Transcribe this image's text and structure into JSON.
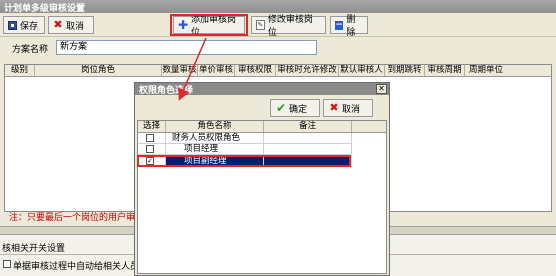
{
  "window": {
    "title": "计划单多级审核设置"
  },
  "toolbar": {
    "save_label": "保存",
    "cancel_label": "取消",
    "add_label": "添加审核岗位",
    "edit_label": "修改审核岗位",
    "delete_label": "删除"
  },
  "scheme": {
    "label": "方案名称",
    "value": "新方案"
  },
  "grid": {
    "columns": [
      "级别",
      "岗位角色",
      "数量审核",
      "单价审核",
      "审核权限",
      "审核时允许修改",
      "默认审核人",
      "到期跳转",
      "审核周期",
      "周期单位"
    ]
  },
  "note": "注：只要最后一个岗位的用户审核",
  "lower": {
    "section_label": "核相关开关设置",
    "checkbox_label": "单据审核过程中自动给相关人员发"
  },
  "dialog": {
    "title": "权限角色选择",
    "ok_label": "确定",
    "cancel_label": "取消",
    "columns": [
      "选择",
      "角色名称",
      "备注"
    ],
    "rows": [
      {
        "checked": "",
        "name": "财务人员权限角色",
        "remark": ""
      },
      {
        "checked": "",
        "name": "项目经理",
        "remark": ""
      },
      {
        "checked": "✓",
        "name": "项目副经理",
        "remark": ""
      }
    ]
  },
  "colors": {
    "highlight": "#e2262a",
    "selected_row": "#0a1e6e",
    "note_red": "#cc0000"
  }
}
